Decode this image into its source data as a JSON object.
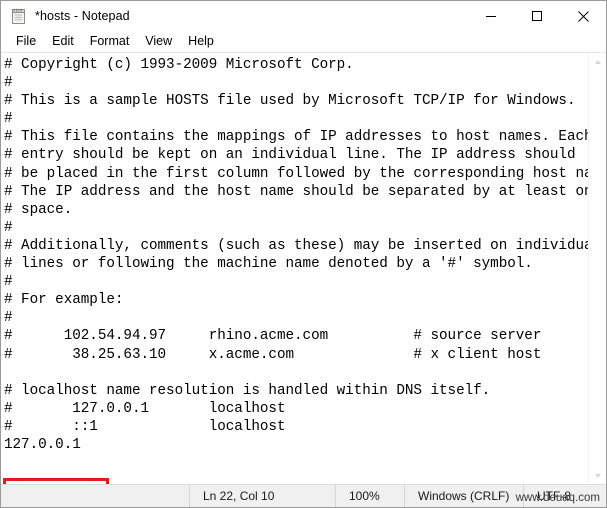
{
  "window": {
    "title": "*hosts - Notepad",
    "icon": "notepad-icon",
    "controls": {
      "minimize": "minimize-icon",
      "maximize": "maximize-icon",
      "close": "close-icon"
    }
  },
  "menubar": {
    "items": [
      {
        "label": "File"
      },
      {
        "label": "Edit"
      },
      {
        "label": "Format"
      },
      {
        "label": "View"
      },
      {
        "label": "Help"
      }
    ]
  },
  "editor": {
    "lines": [
      "# Copyright (c) 1993-2009 Microsoft Corp.",
      "#",
      "# This is a sample HOSTS file used by Microsoft TCP/IP for Windows.",
      "#",
      "# This file contains the mappings of IP addresses to host names. Each",
      "# entry should be kept on an individual line. The IP address should",
      "# be placed in the first column followed by the corresponding host name.",
      "# The IP address and the host name should be separated by at least one",
      "# space.",
      "#",
      "# Additionally, comments (such as these) may be inserted on individual",
      "# lines or following the machine name denoted by a '#' symbol.",
      "#",
      "# For example:",
      "#",
      "#      102.54.94.97     rhino.acme.com          # source server",
      "#       38.25.63.10     x.acme.com              # x client host",
      "",
      "# localhost name resolution is handled within DNS itself.",
      "#       127.0.0.1       localhost",
      "#       ::1             localhost",
      "127.0.0.1"
    ],
    "scrollbar": {
      "up_arrow": "scroll-up-icon",
      "down_arrow": "scroll-down-icon"
    }
  },
  "annotation": {
    "highlighted_text": "127.0.0.1",
    "color": "#e41b17"
  },
  "statusbar": {
    "position": "Ln 22, Col 10",
    "zoom": "100%",
    "line_ending": "Windows (CRLF)",
    "encoding": "UTF-8"
  },
  "watermark": {
    "text": "www.deuaq.com"
  }
}
